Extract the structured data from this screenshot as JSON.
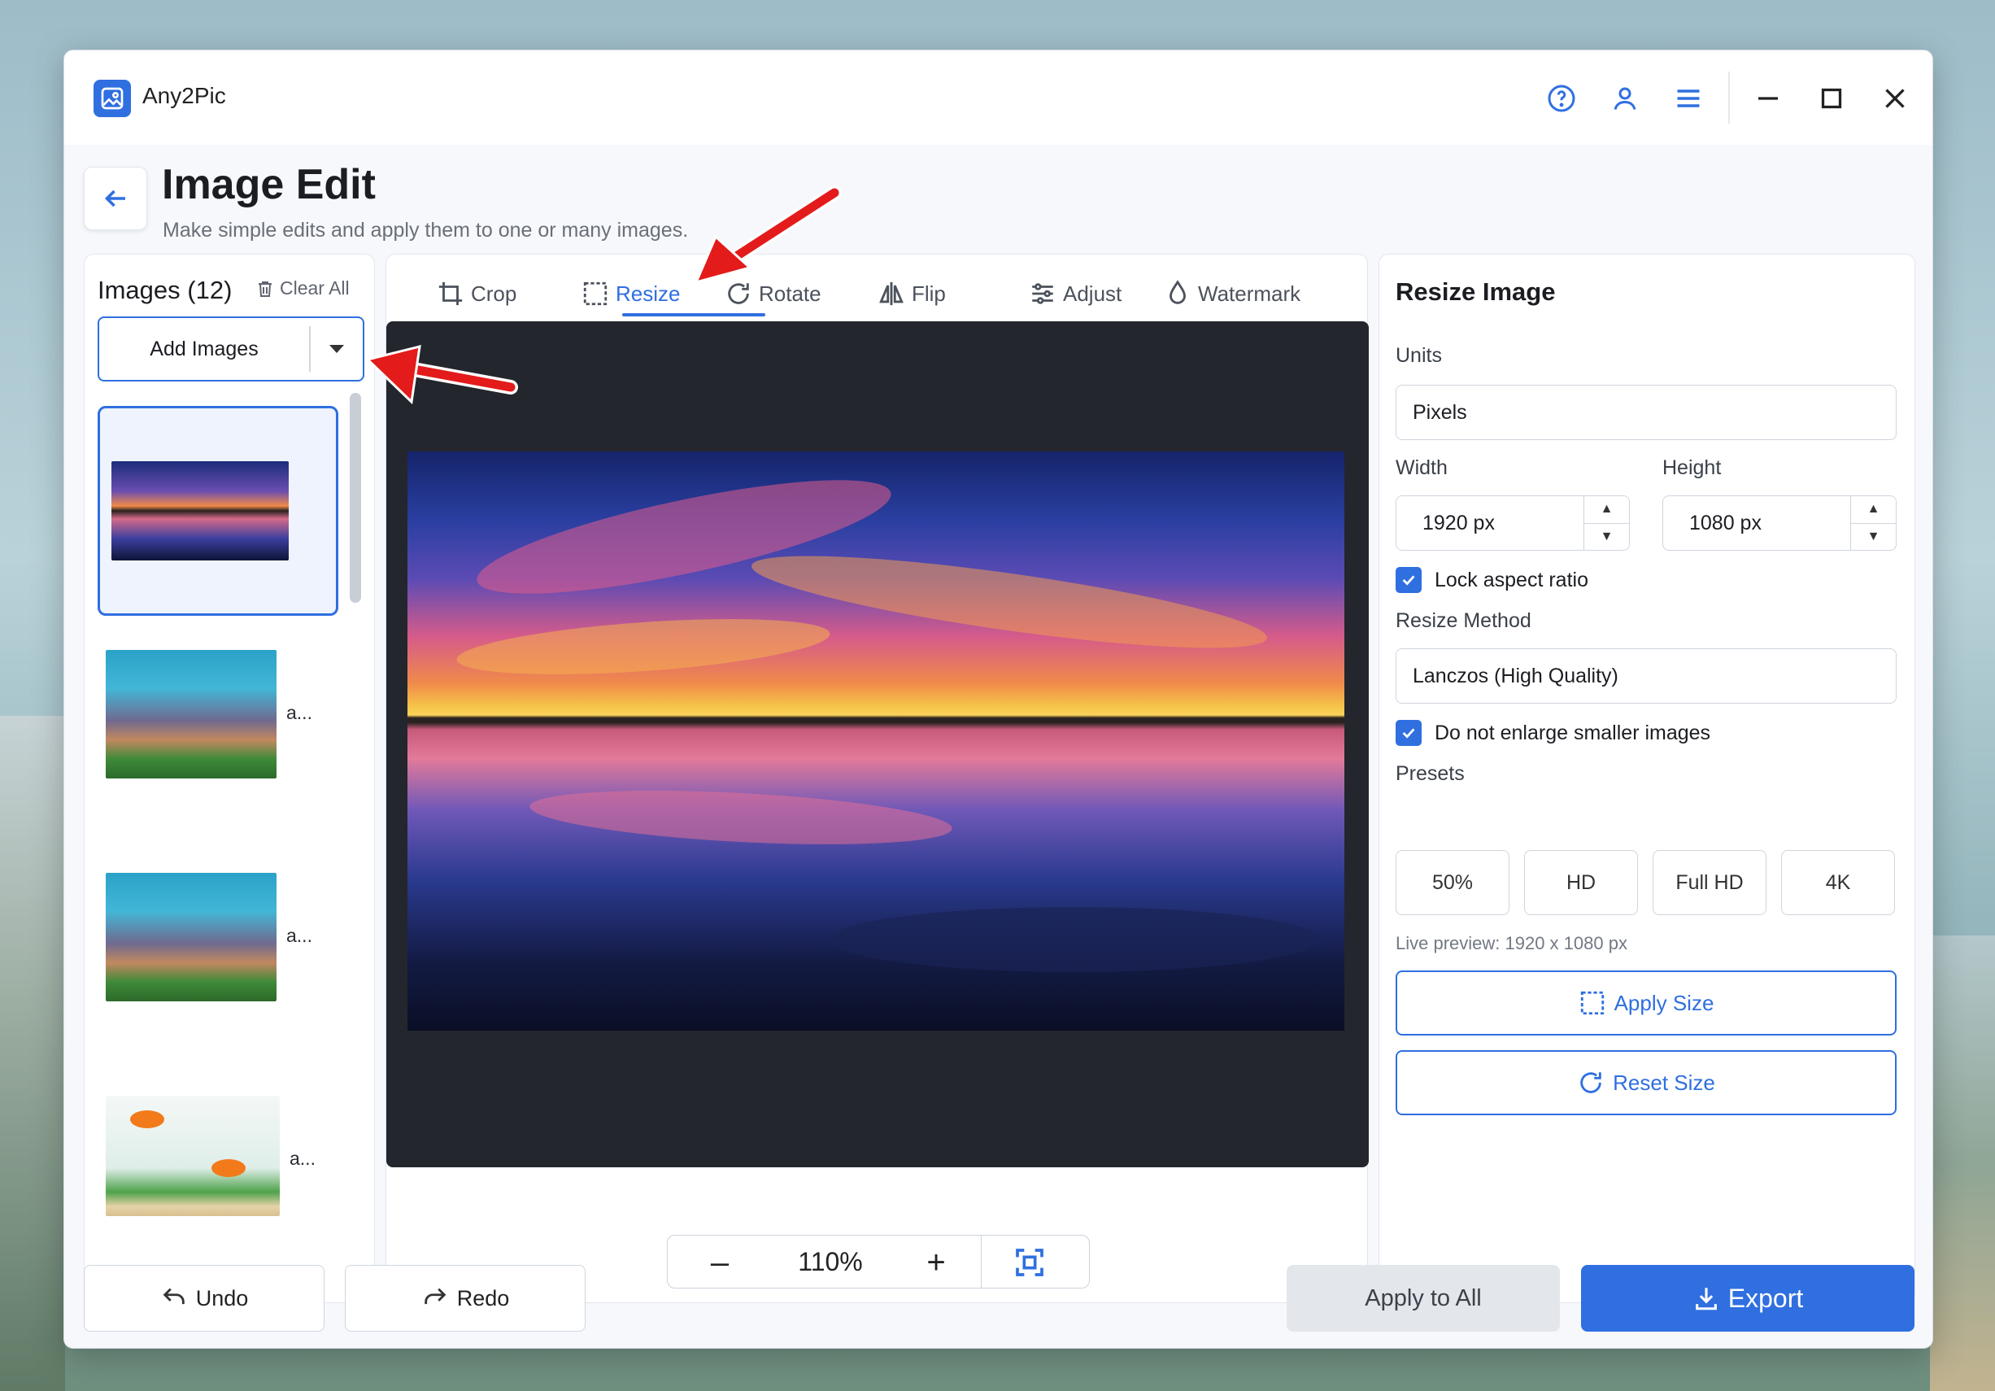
{
  "app": {
    "name": "Any2Pic",
    "brand_color": "#2f6fe0"
  },
  "titlebar": {
    "icons": [
      "help-icon",
      "account-icon",
      "menu-icon",
      "minimize-icon",
      "maximize-icon",
      "close-icon"
    ]
  },
  "header": {
    "title": "Image Edit",
    "subtitle": "Make simple edits and apply them to one or many images."
  },
  "images_panel": {
    "title": "Images (12)",
    "clear_all": "Clear All",
    "add_images": "Add Images",
    "items": [
      {
        "name": "",
        "selected": true
      },
      {
        "name": "a..."
      },
      {
        "name": "a..."
      },
      {
        "name": "a..."
      }
    ]
  },
  "tabs": [
    {
      "label": "Crop",
      "icon": "crop-icon"
    },
    {
      "label": "Resize",
      "icon": "resize-icon",
      "active": true
    },
    {
      "label": "Rotate",
      "icon": "rotate-icon"
    },
    {
      "label": "Flip",
      "icon": "flip-icon"
    },
    {
      "label": "Adjust",
      "icon": "sliders-icon"
    },
    {
      "label": "Watermark",
      "icon": "droplet-icon"
    }
  ],
  "zoom": {
    "minus": "–",
    "value": "110%",
    "plus": "+"
  },
  "resize_panel": {
    "title": "Resize Image",
    "units_label": "Units",
    "units_value": "Pixels",
    "width_label": "Width",
    "width_value": "1920 px",
    "height_label": "Height",
    "height_value": "1080 px",
    "lock_aspect": "Lock aspect ratio",
    "method_label": "Resize Method",
    "method_value": "Lanczos (High Quality)",
    "no_enlarge": "Do not enlarge smaller images",
    "presets_label": "Presets",
    "presets": [
      "50%",
      "HD",
      "Full HD",
      "4K"
    ],
    "live_preview": "Live preview: 1920 x 1080 px",
    "apply_size": "Apply Size",
    "reset_size": "Reset Size"
  },
  "footer": {
    "undo": "Undo",
    "redo": "Redo",
    "apply_to_all": "Apply to All",
    "export": "Export"
  }
}
